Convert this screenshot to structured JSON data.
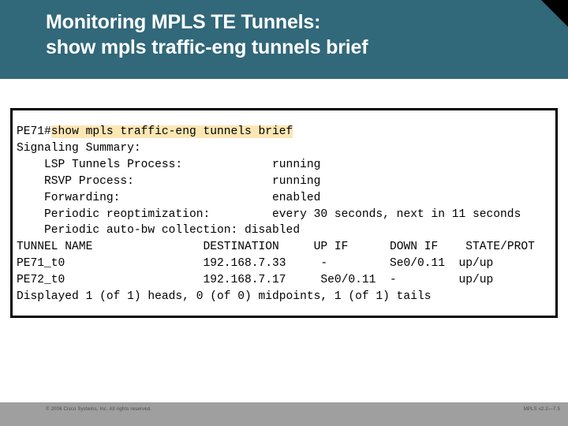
{
  "header": {
    "title_line1": "Monitoring MPLS TE Tunnels:",
    "title_line2": "show mpls traffic-eng tunnels brief",
    "title_full": "Monitoring MPLS TE Tunnels:\nshow mpls traffic-eng tunnels brief",
    "background_color": "#31687a",
    "text_color": "#ffffff",
    "corner_wedge_color": "#000000"
  },
  "terminal": {
    "prompt": "PE71#",
    "command": "show mpls traffic-eng tunnels brief",
    "command_highlight_color": "#fce6b4",
    "signaling_summary_label": "Signaling Summary:",
    "summary_rows": [
      {
        "label": "LSP Tunnels Process:",
        "value": "running"
      },
      {
        "label": "RSVP Process:",
        "value": "running"
      },
      {
        "label": "Forwarding:",
        "value": "enabled"
      },
      {
        "label": "Periodic reoptimization:",
        "value": "every 30 seconds, next in 11 seconds"
      },
      {
        "label": "Periodic auto-bw collection:",
        "value": "disabled"
      }
    ],
    "table": {
      "headers": [
        "TUNNEL NAME",
        "DESTINATION",
        "UP IF",
        "DOWN IF",
        "STATE/PROT"
      ],
      "rows": [
        {
          "tunnel_name": "PE71_t0",
          "destination": "192.168.7.33",
          "up_if": "-",
          "down_if": "Se0/0.11",
          "state_prot": "up/up"
        },
        {
          "tunnel_name": "PE72_t0",
          "destination": "192.168.7.17",
          "up_if": "Se0/0.11",
          "down_if": "-",
          "state_prot": "up/up"
        }
      ]
    },
    "footer_line": "Displayed 1 (of 1) heads, 0 (of 0) midpoints, 1 (of 1) tails",
    "raw_lines": [
      "PE71#show mpls traffic-eng tunnels brief",
      "Signaling Summary:",
      "    LSP Tunnels Process:             running",
      "    RSVP Process:                    running",
      "    Forwarding:                      enabled",
      "    Periodic reoptimization:         every 30 seconds, next in 11 seconds",
      "    Periodic auto-bw collection:     disabled",
      "TUNNEL NAME                DESTINATION      UP IF     DOWN IF   STATE/PROT",
      "PE71_t0                    192.168.7.33     -         Se0/0.11  up/up",
      "PE72_t0                    192.168.7.17     Se0/0.11  -         up/up",
      "Displayed 1 (of 1) heads, 0 (of 0) midpoints, 1 (of 1) tails"
    ]
  },
  "footer": {
    "copyright": "© 2006 Cisco Systems, Inc. All rights reserved.",
    "course_code": "MPLS v2.2—7.5",
    "background_color": "#9f9f9f"
  }
}
